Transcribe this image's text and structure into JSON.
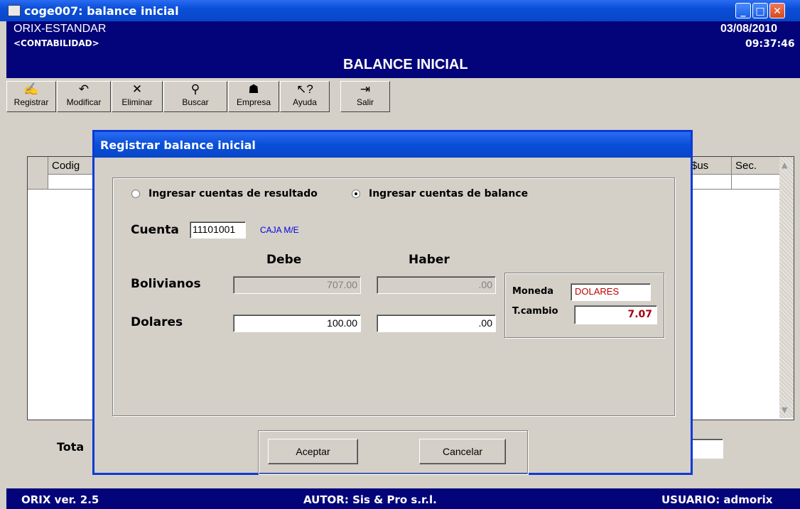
{
  "window": {
    "title": "coge007: balance inicial"
  },
  "header": {
    "company": "ORIX-ESTANDAR",
    "module": "<CONTABILIDAD>",
    "title": "BALANCE INICIAL",
    "date": "03/08/2010",
    "time": "09:37:46"
  },
  "toolbar": [
    {
      "label": "Registrar",
      "icon": "register-icon",
      "glyph": "✍"
    },
    {
      "label": "Modificar",
      "icon": "undo-icon",
      "glyph": "↶"
    },
    {
      "label": "Eliminar",
      "icon": "delete-icon",
      "glyph": "✕"
    },
    {
      "label": "Buscar",
      "icon": "binoculars-icon",
      "glyph": "⚲"
    },
    {
      "label": "Empresa",
      "icon": "company-icon",
      "glyph": "☗"
    },
    {
      "label": "Ayuda",
      "icon": "help-icon",
      "glyph": "↖?"
    },
    {
      "label": "Salir",
      "icon": "exit-icon",
      "glyph": "⇥"
    }
  ],
  "grid": {
    "columns": {
      "codigo": "Codig",
      "sus": "$us",
      "sec": "Sec."
    }
  },
  "totals_label": "Tota",
  "dialog": {
    "title": "Registrar balance inicial",
    "radio_result": "Ingresar cuentas de resultado",
    "radio_balance": "Ingresar cuentas de balance",
    "cuenta_label": "Cuenta",
    "cuenta_value": "11101001",
    "cuenta_desc": "CAJA M/E",
    "debe_label": "Debe",
    "haber_label": "Haber",
    "bolivianos_label": "Bolivianos",
    "dolares_label": "Dolares",
    "bs_debe": "707.00",
    "bs_haber": ".00",
    "usd_debe": "100.00",
    "usd_haber": ".00",
    "moneda_label": "Moneda",
    "moneda_value": "DOLARES",
    "tcambio_label": "T.cambio",
    "tcambio_value": "7.07",
    "accept": "Aceptar",
    "cancel": "Cancelar"
  },
  "status": {
    "version": "ORIX ver. 2.5",
    "author": "AUTOR: Sis & Pro s.r.l.",
    "user": "USUARIO: admorix"
  },
  "colors": {
    "header_bg": "#04047a",
    "accent_blue": "#0a4fd8",
    "red_text": "#c00000"
  }
}
